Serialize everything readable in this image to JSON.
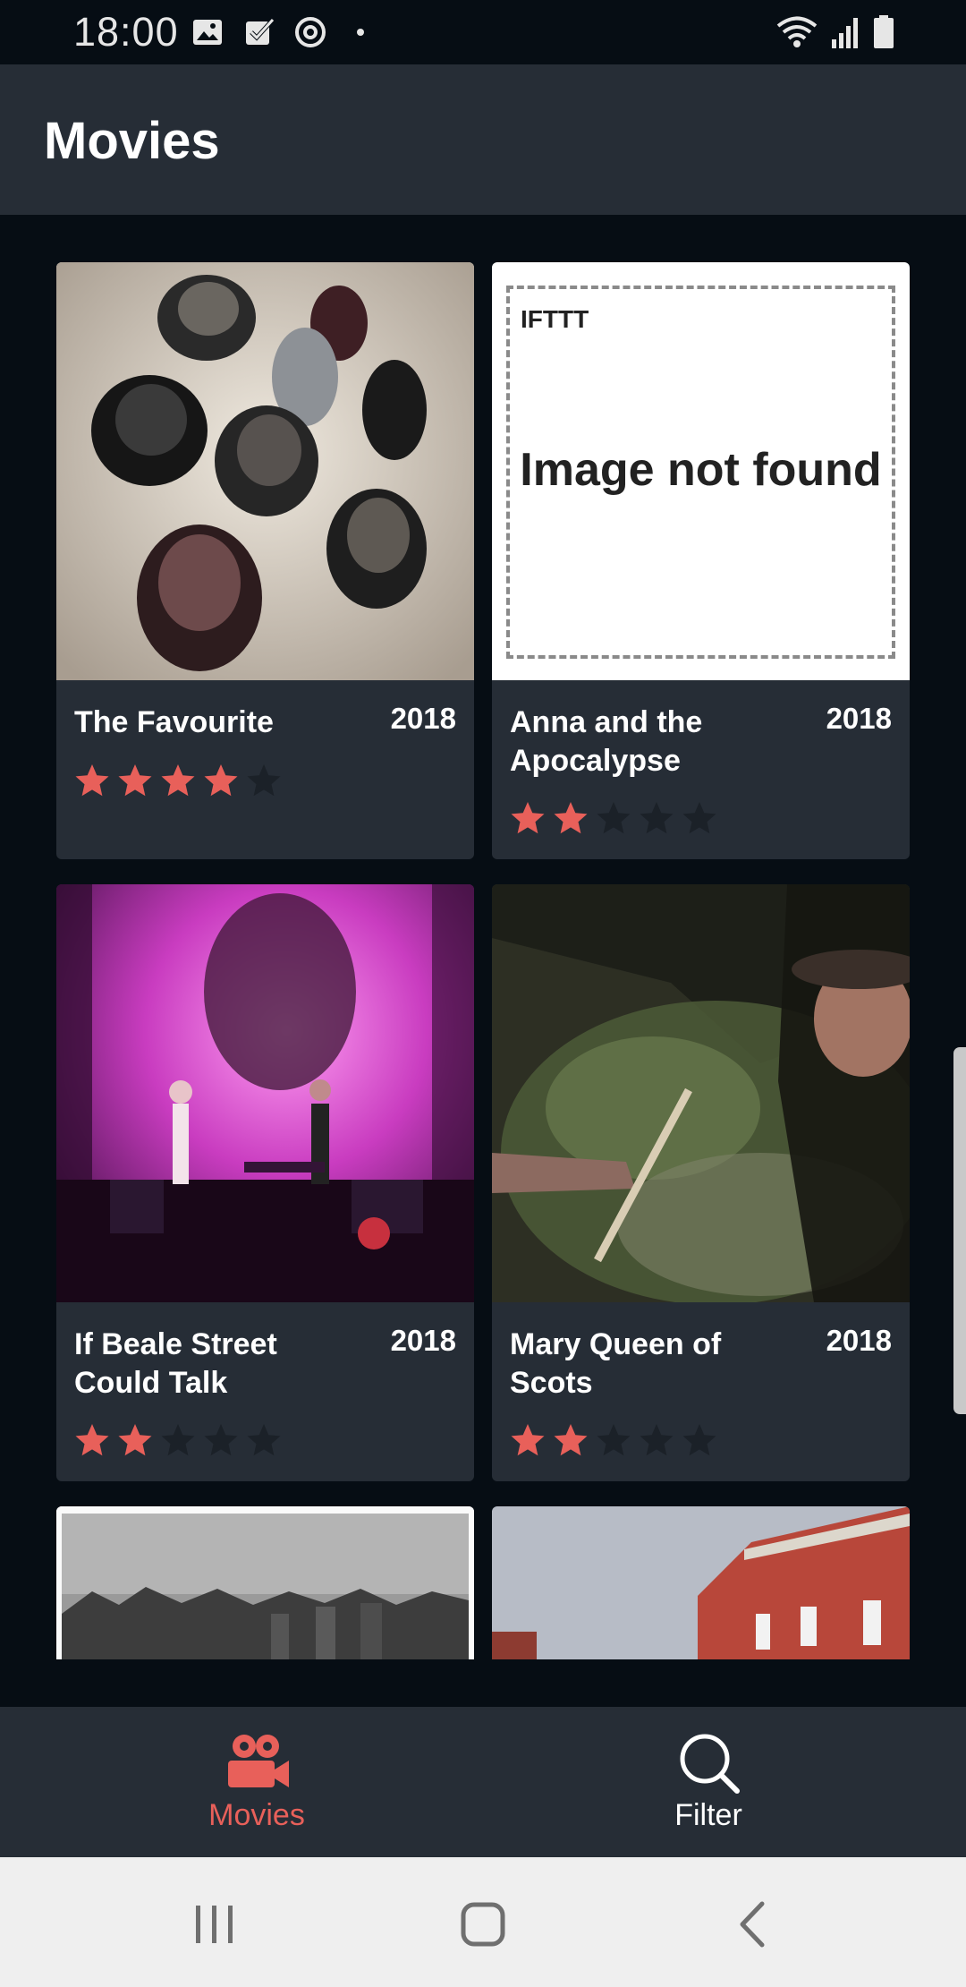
{
  "status_bar": {
    "time": "18:00",
    "left_icons": [
      "gallery-icon",
      "check-icon",
      "sync-icon",
      "dot-icon"
    ],
    "right_icons": [
      "wifi-icon",
      "signal-icon",
      "battery-icon"
    ]
  },
  "app_bar": {
    "title": "Movies"
  },
  "movies": [
    {
      "title": "The Favourite",
      "year": "2018",
      "rating": 4,
      "max_rating": 5,
      "image": "hats-photo"
    },
    {
      "title": "Anna and the Apocalypse",
      "year": "2018",
      "rating": 2,
      "max_rating": 5,
      "image": "image-not-found",
      "placeholder_brand": "IFTTT",
      "placeholder_text": "Image not found"
    },
    {
      "title": "If Beale Street Could Talk",
      "year": "2018",
      "rating": 2,
      "max_rating": 5,
      "image": "concert-photo"
    },
    {
      "title": "Mary Queen of Scots",
      "year": "2018",
      "rating": 2,
      "max_rating": 5,
      "image": "night-forest-photo"
    },
    {
      "title": "",
      "year": "",
      "rating": null,
      "image": "bw-group-photo"
    },
    {
      "title": "",
      "year": "",
      "rating": null,
      "image": "brick-building-photo"
    }
  ],
  "bottom_nav": {
    "items": [
      {
        "label": "Movies",
        "icon": "movie-camera-icon",
        "active": true
      },
      {
        "label": "Filter",
        "icon": "search-icon",
        "active": false
      }
    ]
  },
  "colors": {
    "accent": "#e8605a",
    "star_empty": "#1b2128",
    "card_bg": "#262d36",
    "page_bg": "#060d14"
  }
}
